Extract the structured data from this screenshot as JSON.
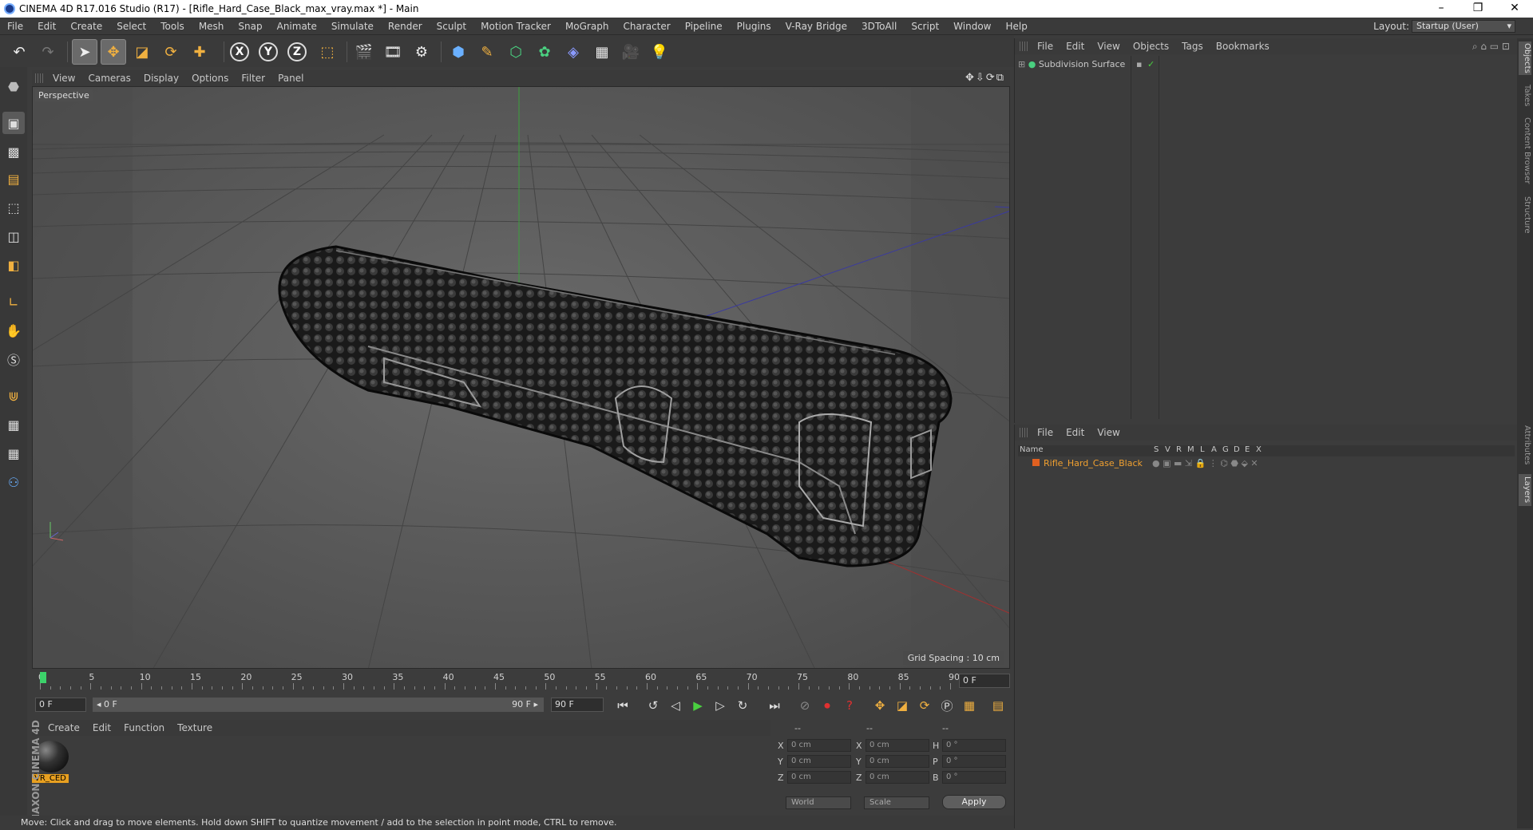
{
  "window": {
    "title": "CINEMA 4D R17.016 Studio (R17) - [Rifle_Hard_Case_Black_max_vray.max *] - Main",
    "controls": [
      "–",
      "❐",
      "✕"
    ]
  },
  "menubar": {
    "items": [
      "File",
      "Edit",
      "Create",
      "Select",
      "Tools",
      "Mesh",
      "Snap",
      "Animate",
      "Simulate",
      "Render",
      "Sculpt",
      "Motion Tracker",
      "MoGraph",
      "Character",
      "Pipeline",
      "Plugins",
      "V-Ray Bridge",
      "3DToAll",
      "Script",
      "Window",
      "Help"
    ],
    "layout_label": "Layout:",
    "layout_value": "Startup (User)"
  },
  "toolbar": {
    "axis_x": "X",
    "axis_y": "Y",
    "axis_z": "Z"
  },
  "viewport": {
    "menu": [
      "View",
      "Cameras",
      "Display",
      "Options",
      "Filter",
      "Panel"
    ],
    "nav_icons": "✥⇩⟳⧉",
    "label": "Perspective",
    "grid_spacing": "Grid Spacing : 10 cm"
  },
  "timeline": {
    "ticks": [
      "0",
      "5",
      "10",
      "15",
      "20",
      "25",
      "30",
      "35",
      "40",
      "45",
      "50",
      "55",
      "60",
      "65",
      "70",
      "75",
      "80",
      "85",
      "90"
    ],
    "current_frame": "0 F"
  },
  "transport": {
    "start_field": "0 F",
    "range_start": "◂ 0 F",
    "range_end": "90 F ▸",
    "end_field": "90 F"
  },
  "material_manager": {
    "menu": [
      "Create",
      "Edit",
      "Function",
      "Texture"
    ],
    "material_name": "VR_CED"
  },
  "branding": {
    "text": "MAXON CINEMA 4D"
  },
  "coordinates": {
    "headers": [
      "--",
      "--",
      "--"
    ],
    "rows": [
      {
        "a": "X",
        "av": "0 cm",
        "b": "X",
        "bv": "0 cm",
        "c": "H",
        "cv": "0 °"
      },
      {
        "a": "Y",
        "av": "0 cm",
        "b": "Y",
        "bv": "0 cm",
        "c": "P",
        "cv": "0 °"
      },
      {
        "a": "Z",
        "av": "0 cm",
        "b": "Z",
        "bv": "0 cm",
        "c": "B",
        "cv": "0 °"
      }
    ],
    "mode": "World",
    "size_mode": "Scale",
    "apply": "Apply"
  },
  "status": {
    "text": "Move: Click and drag to move elements. Hold down SHIFT to quantize movement / add to the selection in point mode, CTRL to remove."
  },
  "objects_panel": {
    "menu": [
      "File",
      "Edit",
      "View",
      "Objects",
      "Tags",
      "Bookmarks"
    ],
    "object_name": "Subdivision Surface"
  },
  "layers_panel": {
    "menu": [
      "File",
      "Edit",
      "View"
    ],
    "columns": [
      "Name",
      "S",
      "V",
      "R",
      "M",
      "L",
      "A",
      "G",
      "D",
      "E",
      "X"
    ],
    "layer_name": "Rifle_Hard_Case_Black"
  },
  "right_tabs": [
    "Objects",
    "Takes",
    "Content Browser",
    "Structure",
    "Attributes",
    "Layers"
  ]
}
